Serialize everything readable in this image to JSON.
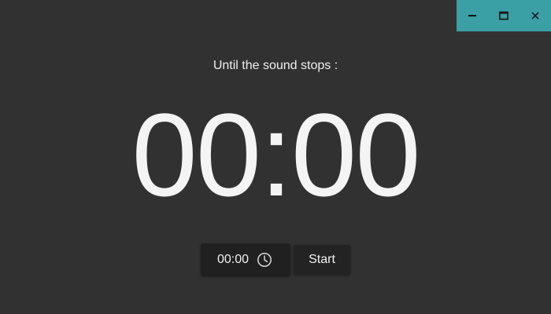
{
  "window": {
    "controls": [
      {
        "name": "minimize-icon"
      },
      {
        "name": "maximize-icon"
      },
      {
        "name": "close-icon"
      }
    ],
    "controls_color": "#3aa0a6"
  },
  "timer": {
    "subtitle": "Until the sound stops :",
    "display": "00:00"
  },
  "controls": {
    "time_input_value": "00:00",
    "time_input_icon": "clock-icon",
    "start_label": "Start"
  },
  "colors": {
    "background": "#313131",
    "input_background": "#202020",
    "button_background": "#232323",
    "text": "#f4f4f4"
  }
}
